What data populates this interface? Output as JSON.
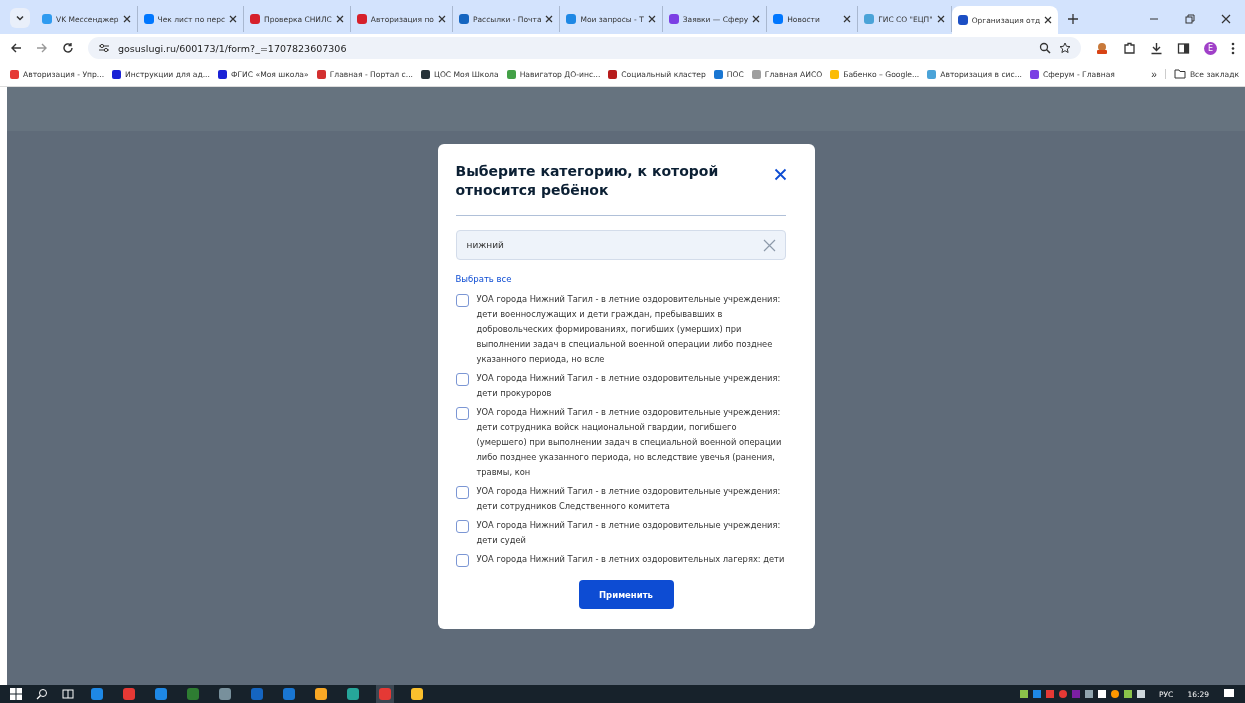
{
  "browser": {
    "tabs": [
      {
        "title": "VK Мессенджер",
        "color": "#2f9bf0",
        "selected": false
      },
      {
        "title": "Чек лист по перс",
        "color": "#0077ff",
        "selected": false
      },
      {
        "title": "Проверка СНИЛС",
        "color": "#d6202b",
        "selected": false
      },
      {
        "title": "Авторизация по",
        "color": "#d6202b",
        "selected": false
      },
      {
        "title": "Рассылки - Почта",
        "color": "#1565c0",
        "selected": false
      },
      {
        "title": "Мои запросы - Т",
        "color": "#1e88e5",
        "selected": false
      },
      {
        "title": "Заявки — Сферу",
        "color": "#7b3fe4",
        "selected": false
      },
      {
        "title": "Новости",
        "color": "#0077ff",
        "selected": false
      },
      {
        "title": "ГИС СО \"ЕЦП\"",
        "color": "#4aa3d8",
        "selected": false
      },
      {
        "title": "Организация отд",
        "color": "#1c4fc4",
        "selected": true
      }
    ],
    "address": "gosuslugi.ru/600173/1/form?_=1707823607306",
    "profile_initial": "E",
    "bookmarks": [
      {
        "title": "Авторизация - Упр...",
        "color": "#e53935"
      },
      {
        "title": "Инструкции для ад...",
        "color": "#1a22d6"
      },
      {
        "title": "ФГИС «Моя школа»",
        "color": "#1a22d6"
      },
      {
        "title": "Главная - Портал с...",
        "color": "#d32f2f"
      },
      {
        "title": "ЦОС Моя Школа",
        "color": "#263238"
      },
      {
        "title": "Навигатор ДО-инс...",
        "color": "#43a047"
      },
      {
        "title": "Социальный кластер",
        "color": "#b71c1c"
      },
      {
        "title": "ПОС",
        "color": "#1976d2"
      },
      {
        "title": "Главная АИСО",
        "color": "#9e9e9e"
      },
      {
        "title": "Бабенко – Google...",
        "color": "#fbbc04"
      },
      {
        "title": "Авторизация в сис...",
        "color": "#4aa3d8"
      },
      {
        "title": "Сферум - Главная",
        "color": "#7b3fe4"
      }
    ],
    "more": "»",
    "all_bookmarks": "Все закладк"
  },
  "modal": {
    "title": "Выберите категорию, к которой относится ребёнок",
    "search": {
      "value": "нижний"
    },
    "select_all": "Выбрать все",
    "options": [
      {
        "label": "УОА города Нижний Тагил - в летние оздоровительные учреждения: дети военнослужащих и дети граждан, пребывавших в добровольческих формированиях, погибших (умерших) при выполнении задач в специальной военной операции либо позднее указанного периода, но всле",
        "checked": false
      },
      {
        "label": "УОА города Нижний Тагил - в летние оздоровительные учреждения: дети прокуроров",
        "checked": false
      },
      {
        "label": "УОА города Нижний Тагил - в летние оздоровительные учреждения: дети сотрудника войск национальной гвардии, погибшего (умершего) при выполнении задач в специальной военной операции либо позднее указанного периода, но вследствие увечья (ранения, травмы, кон",
        "checked": false
      },
      {
        "label": "УОА города Нижний Тагил - в летние оздоровительные учреждения: дети сотрудников Следственного комитета",
        "checked": false
      },
      {
        "label": "УОА города Нижний Тагил - в летние оздоровительные учреждения: дети судей",
        "checked": false
      },
      {
        "label": "УОА города Нижний Тагил - в летних оздоровительных лагерях: дети",
        "checked": false
      }
    ],
    "apply": "Применить"
  },
  "taskbar": {
    "apps": [
      {
        "color": "#1e88e5",
        "selected": false
      },
      {
        "color": "#e53935",
        "selected": false
      },
      {
        "color": "#1e88e5",
        "selected": false
      },
      {
        "color": "#2e7d32",
        "selected": false
      },
      {
        "color": "#78909c",
        "selected": false
      },
      {
        "color": "#1565c0",
        "selected": false
      },
      {
        "color": "#1976d2",
        "selected": false
      },
      {
        "color": "#f9a825",
        "selected": false
      },
      {
        "color": "#26a69a",
        "selected": false
      },
      {
        "color": "#e53935",
        "selected": true
      },
      {
        "color": "#fbc02d",
        "selected": false
      }
    ],
    "language": "РУС",
    "time": "16:29"
  }
}
